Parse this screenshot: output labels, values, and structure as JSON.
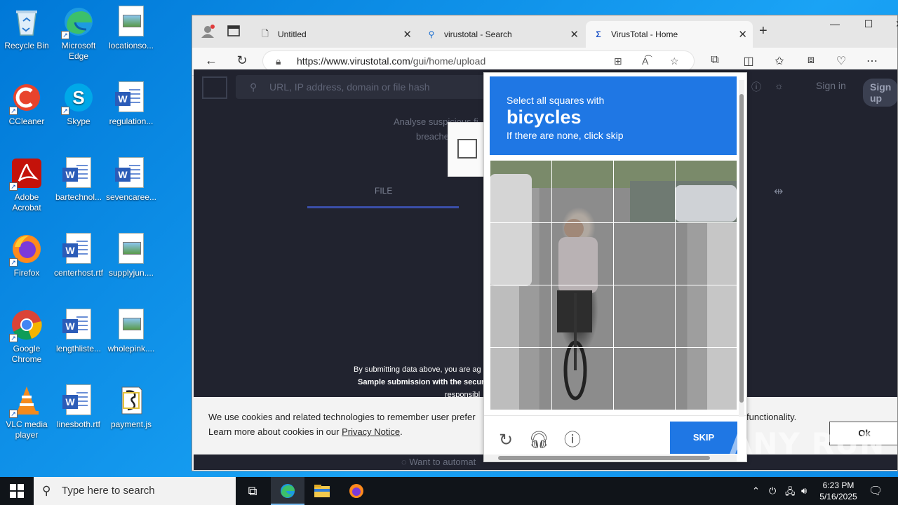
{
  "desktop": {
    "icons": [
      {
        "label": "Recycle Bin"
      },
      {
        "label": "Microsoft Edge"
      },
      {
        "label": "locationso..."
      },
      {
        "label": "CCleaner"
      },
      {
        "label": "Skype"
      },
      {
        "label": "regulation..."
      },
      {
        "label": "Adobe Acrobat"
      },
      {
        "label": "bartechnol..."
      },
      {
        "label": "sevencaree..."
      },
      {
        "label": "Firefox"
      },
      {
        "label": "centerhost.rtf"
      },
      {
        "label": "supplyjun...."
      },
      {
        "label": "Google Chrome"
      },
      {
        "label": "lengthliste..."
      },
      {
        "label": "wholepink...."
      },
      {
        "label": "VLC media player"
      },
      {
        "label": "linesboth.rtf"
      },
      {
        "label": "payment.js"
      }
    ]
  },
  "browser": {
    "tabs": [
      {
        "title": "Untitled"
      },
      {
        "title": "virustotal - Search"
      },
      {
        "title": "VirusTotal - Home"
      }
    ],
    "url_host": "https://www.virustotal.com",
    "url_path": "/gui/home/upload"
  },
  "virustotal": {
    "search_placeholder": "URL, IP address, domain or file hash",
    "sign_in": "Sign in",
    "sign_up": "Sign up",
    "intro_1": "Analyse suspicious fi",
    "intro_2": "breache",
    "file_tab": "FILE",
    "submit_1": "By submitting data above, you are ag",
    "submit_1_end": "ur",
    "submit_2": "Sample submission with the secur",
    "submit_3": "responsibl",
    "automate": "Want to automat"
  },
  "cookie_banner": {
    "line1": "We use cookies and related technologies to remember user prefer",
    "line1_end": "functionality.",
    "line2_pre": "Learn more about cookies in our ",
    "line2_link": "Privacy Notice",
    "line2_post": ".",
    "ok": "Ok"
  },
  "captcha": {
    "prompt_line1": "Select all squares with",
    "target": "bicycles",
    "prompt_line3": "If there are none, click skip",
    "skip": "SKIP"
  },
  "watermark": "ANY RUN",
  "taskbar": {
    "search_placeholder": "Type here to search",
    "time": "6:23 PM",
    "date": "5/16/2025"
  }
}
